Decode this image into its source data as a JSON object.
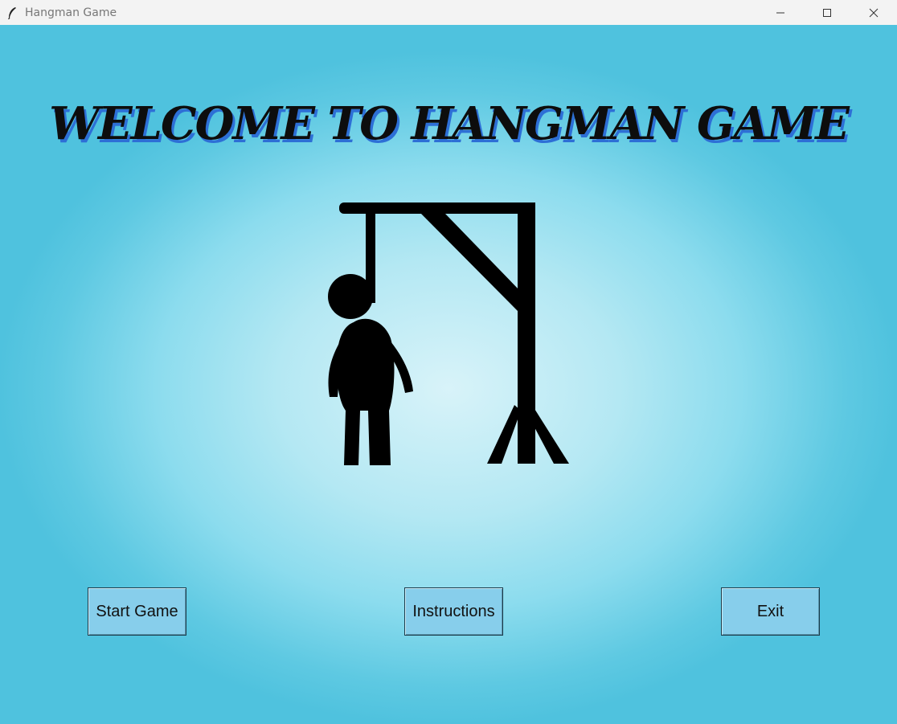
{
  "window": {
    "title": "Hangman Game",
    "icon": "feather-icon",
    "controls": [
      "minimize-icon",
      "maximize-icon",
      "close-icon"
    ]
  },
  "main": {
    "headline": "WELCOME TO HANGMAN GAME",
    "illustration": "hangman-gallows-image"
  },
  "buttons": {
    "start": "Start Game",
    "instructions": "Instructions",
    "exit": "Exit"
  },
  "colors": {
    "background": "#8cdcee",
    "button": "#87ceeb",
    "headline_shadow": "#2d6fd6"
  }
}
